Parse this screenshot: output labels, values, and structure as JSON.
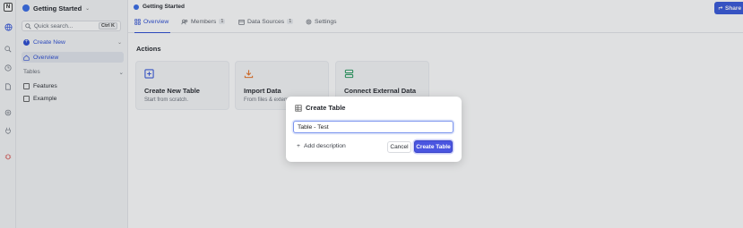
{
  "rail": {
    "logo": "N",
    "icons": [
      "globe-icon",
      "search-icon",
      "clock-icon",
      "file-icon",
      "settings-icon",
      "plug-icon",
      "bug-icon"
    ]
  },
  "sidebar": {
    "workspace": "Getting Started",
    "search_placeholder": "Quick search...",
    "search_shortcut": "Ctrl K",
    "create_new": "Create New",
    "overview": "Overview",
    "tables_header": "Tables",
    "tables": [
      "Features",
      "Example"
    ]
  },
  "header": {
    "breadcrumb": "Getting Started",
    "share": "Share"
  },
  "tabs": [
    {
      "label": "Overview",
      "count": ""
    },
    {
      "label": "Members",
      "count": "1"
    },
    {
      "label": "Data Sources",
      "count": "1"
    },
    {
      "label": "Settings",
      "count": ""
    }
  ],
  "main": {
    "actions_title": "Actions",
    "cards": [
      {
        "title": "Create New Table",
        "subtitle": "Start from scratch.",
        "color": "#3b5bdb"
      },
      {
        "title": "Import Data",
        "subtitle": "From files & externa",
        "color": "#e8762b"
      },
      {
        "title": "Connect External Data",
        "subtitle": "",
        "color": "#2f9e64"
      }
    ]
  },
  "modal": {
    "title": "Create Table",
    "input_value": "Table - Test",
    "add_description": "Add description",
    "cancel": "Cancel",
    "create": "Create Table"
  }
}
